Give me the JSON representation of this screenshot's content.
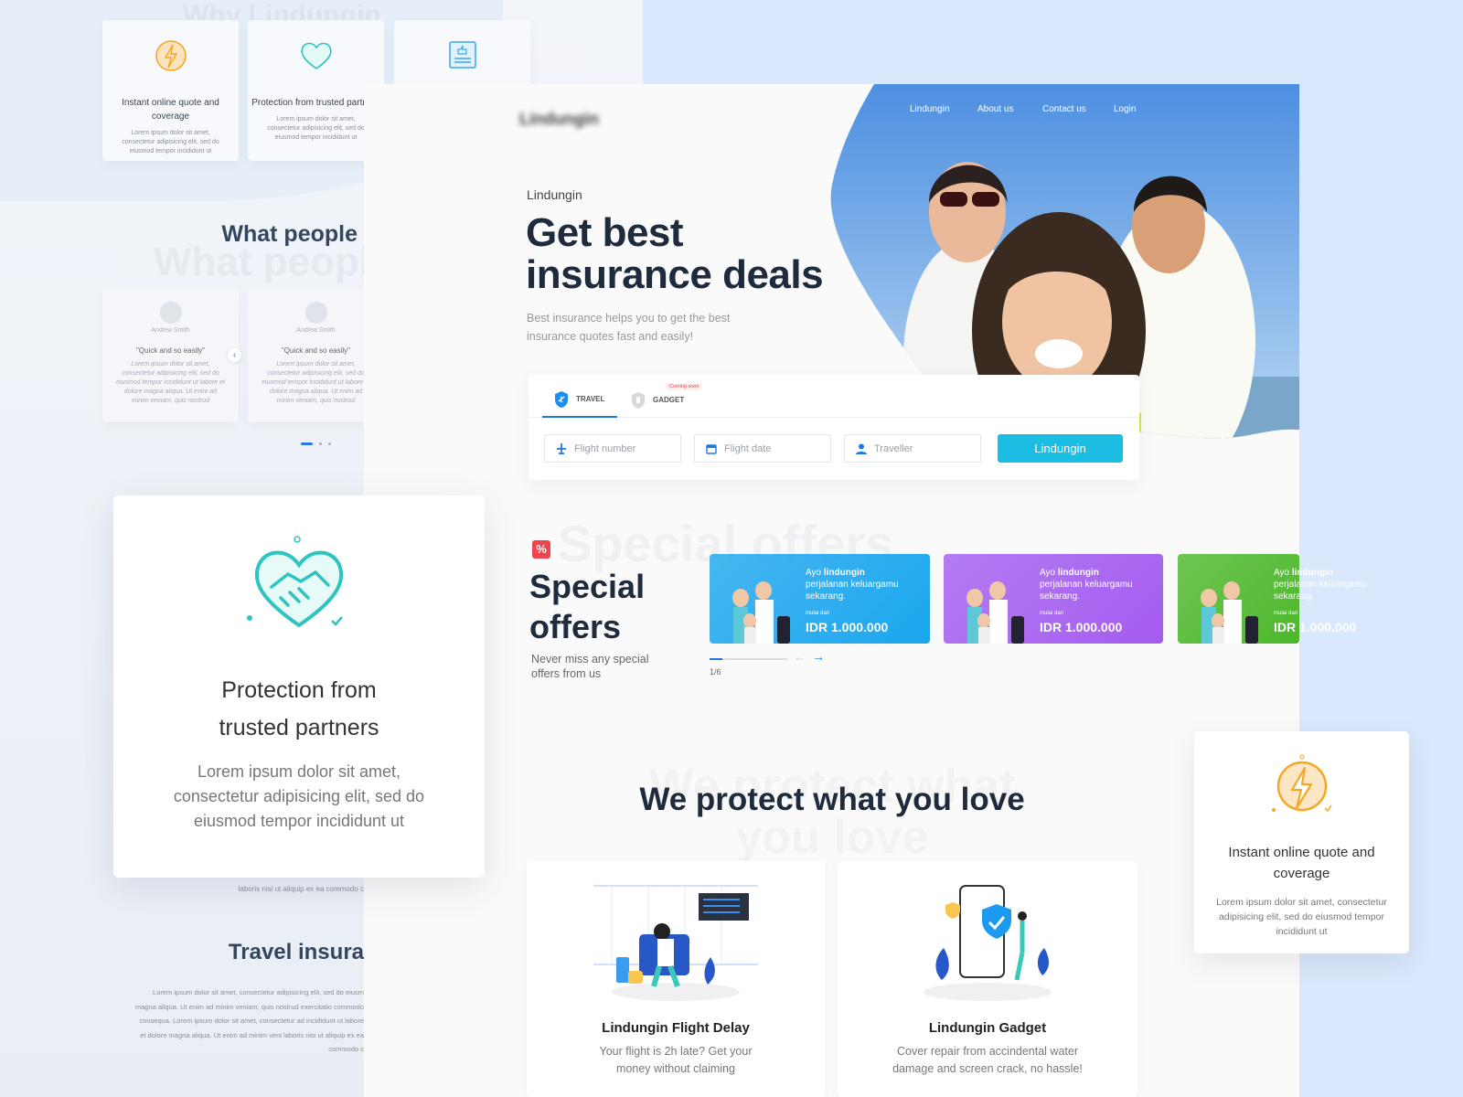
{
  "background_sections": {
    "why_ghost": "Why Lindungin",
    "features": [
      {
        "icon": "lightning-icon",
        "title": "Instant online quote and coverage",
        "text": "Lorem ipsum dolor sit amet, consectetur adipisicing elit, sed do eiusmod tempor incididunt ut"
      },
      {
        "icon": "handshake-heart-icon",
        "title": "Protection from trusted partners",
        "text": "Lorem ipsum dolor sit amet, consectetur adipisicing elit, sed do eiusmod tempor incididunt ut"
      },
      {
        "icon": "thumbs-up-document-icon",
        "title": "",
        "text": ""
      }
    ],
    "testimonials_title": "What people",
    "testimonials_ghost": "What people",
    "testimonials": [
      {
        "name": "Andrea Smith",
        "quote": "\"Quick and so easily\"",
        "text": "Lorem ipsum dolor sit amet, consectetur adipisicing elit, sed do eiusmod tempor incididunt ut labore et dolore magna aliqua. Ut enim ad minim veniam, quis nostrud"
      },
      {
        "name": "Andrea Smith",
        "quote": "\"Quick and so easily\"",
        "text": "Lorem ipsum dolor sit amet, consectetur adipisicing elit, sed do eiusmod tempor incididunt ut labore et dolore magna aliqua. Ut enim ad minim veniam, quis nostrud"
      }
    ],
    "behind_text": "laboris nisi ut aliquip ex ea commodo c",
    "travel_title": "Travel insura",
    "travel_text": "Lorem ipsum dolor sit amet, consectetur adipisicing elit, sed do eiusm magna aliqua. Ut enim ad minim veniam, quis nostrud exercitatio commodo consequa. Lorem ipsum dolor sit amet, consectetur ad incididunt ut labore et dolore magna aliqua. Ut enim ad minim veni laboris nisi ut aliquip ex ea commodo c"
  },
  "feature_card_large": {
    "title": "Protection from trusted partners",
    "text": "Lorem ipsum dolor sit amet, consectetur adipisicing elit, sed do eiusmod tempor incididunt ut"
  },
  "feature_card_right": {
    "title": "Instant online quote and coverage",
    "text": "Lorem ipsum dolor sit amet, consectetur adipisicing elit, sed do eiusmod tempor incididunt ut"
  },
  "header": {
    "logo": "Lindungin",
    "nav": [
      "Lindungin",
      "About us",
      "Contact us",
      "Login"
    ]
  },
  "hero": {
    "eyebrow": "Lindungin",
    "title_line1": "Get best",
    "title_line2": "insurance deals",
    "subtitle_line1": "Best insurance helps you to get the best",
    "subtitle_line2": "insurance quotes fast and easily!"
  },
  "search": {
    "tabs": [
      {
        "label": "TRAVEL",
        "active": true
      },
      {
        "label": "GADGET",
        "badge": "Coming soon"
      }
    ],
    "fields": [
      {
        "placeholder": "Flight number",
        "icon": "airplane-icon"
      },
      {
        "placeholder": "Flight date",
        "icon": "calendar-icon"
      },
      {
        "placeholder": "Traveller",
        "icon": "user-icon"
      }
    ],
    "button": "Lindungin"
  },
  "offers": {
    "ghost": "Special offers",
    "title_line1": "Special",
    "title_line2": "offers",
    "subtitle_line1": "Never miss any special",
    "subtitle_line2": "offers from us",
    "cards": [
      {
        "line1_pre": "Ayo ",
        "line1_bold": "lindungin",
        "line2": "perjalanan keluargamu",
        "line3": "sekarang.",
        "small": "mulai dari",
        "price": "IDR 1.000.000",
        "color": "#1aa6ee"
      },
      {
        "line1_pre": "Ayo ",
        "line1_bold": "lindungin",
        "line2": "perjalanan keluargamu",
        "line3": "sekarang.",
        "small": "mulai dari",
        "price": "IDR 1.000.000",
        "color": "#a45cf0"
      },
      {
        "line1_pre": "Ayo ",
        "line1_bold": "lindungin",
        "line2": "perjalanan keluargamu",
        "line3": "sekarang.",
        "small": "mulai dari",
        "price": "IDR 1.000.000",
        "color": "#4cb82a"
      }
    ],
    "pager": "1/6",
    "progress": 0.17
  },
  "protect": {
    "title": "We protect what you love",
    "ghost": "We protect what you love",
    "products": [
      {
        "title": "Lindungin Flight Delay",
        "line1": "Your flight is 2h late? Get your",
        "line2": "money without claiming"
      },
      {
        "title": "Lindungin Gadget",
        "line1": "Cover repair from accindental water",
        "line2": "damage and screen crack, no hassle!"
      }
    ]
  },
  "colors": {
    "accent": "#1bbde3",
    "primary": "#1c7be0",
    "heading": "#1d2b3d",
    "badge": "#f0444f"
  }
}
